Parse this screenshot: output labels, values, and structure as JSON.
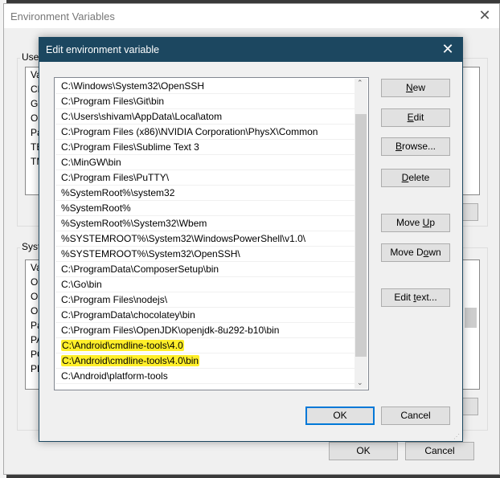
{
  "outer": {
    "title": "Environment Variables",
    "user_group": "User",
    "system_group": "System",
    "user_list": [
      "Va",
      "CH",
      "GO",
      "On",
      "Pa",
      "TE",
      "TM"
    ],
    "system_list": [
      "Va",
      "Or",
      "OI",
      "OS",
      "Pa",
      "PA",
      "PO",
      "PE"
    ],
    "ok": "OK",
    "cancel": "Cancel"
  },
  "dialog": {
    "title": "Edit environment variable",
    "paths": [
      "C:\\Windows\\System32\\OpenSSH",
      "C:\\Program Files\\Git\\bin",
      "C:\\Users\\shivam\\AppData\\Local\\atom",
      "C:\\Program Files (x86)\\NVIDIA Corporation\\PhysX\\Common",
      "C:\\Program Files\\Sublime Text 3",
      "C:\\MinGW\\bin",
      "C:\\Program Files\\PuTTY\\",
      "%SystemRoot%\\system32",
      "%SystemRoot%",
      "%SystemRoot%\\System32\\Wbem",
      "%SYSTEMROOT%\\System32\\WindowsPowerShell\\v1.0\\",
      "%SYSTEMROOT%\\System32\\OpenSSH\\",
      "C:\\ProgramData\\ComposerSetup\\bin",
      "C:\\Go\\bin",
      "C:\\Program Files\\nodejs\\",
      "C:\\ProgramData\\chocolatey\\bin",
      "C:\\Program Files\\OpenJDK\\openjdk-8u292-b10\\bin",
      "C:\\Android\\cmdline-tools\\4.0",
      "C:\\Android\\cmdline-tools\\4.0\\bin",
      "C:\\Android\\platform-tools"
    ],
    "highlighted": [
      17,
      18
    ],
    "highlight_color": "#ffef2a",
    "buttons": {
      "new": "New",
      "edit": "Edit",
      "browse": "Browse...",
      "delete": "Delete",
      "move_up": "Move Up",
      "move_down": "Move Down",
      "edit_text": "Edit text...",
      "ok": "OK",
      "cancel": "Cancel"
    }
  }
}
